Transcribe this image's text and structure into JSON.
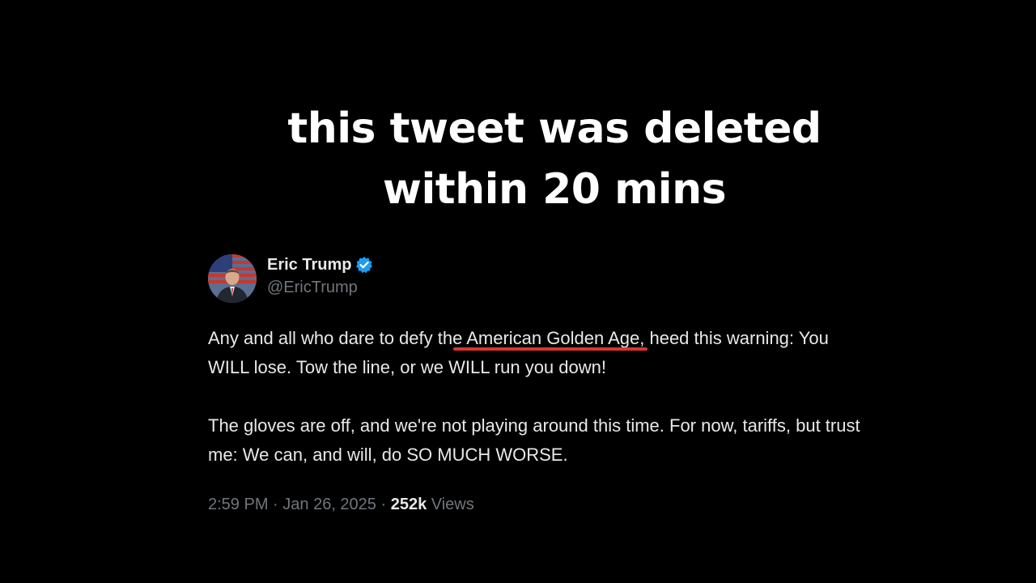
{
  "caption": {
    "line1": "this tweet was deleted",
    "line2": "within 20 mins"
  },
  "tweet": {
    "author": {
      "display_name": "Eric Trump",
      "handle": "@EricTrump",
      "verified": true,
      "avatar_icon": "profile-photo-icon"
    },
    "body": {
      "p1_before": "Any and all who dare to defy the ",
      "p1_highlight": "American Golden Age,",
      "p1_after": " heed this warning: You WILL lose. Tow the line, or we WILL run you down!",
      "p2": "The gloves are off, and we're not playing around this time. For now, tariffs, but trust me: We can, and will, do SO MUCH WORSE."
    },
    "meta": {
      "time": "2:59 PM",
      "sep1": " · ",
      "date": "Jan 26, 2025",
      "sep2": " · ",
      "views_count": "252k",
      "views_label": " Views"
    }
  },
  "colors": {
    "background": "#000000",
    "text_primary": "#e7e9ea",
    "text_secondary": "#71767b",
    "verified_blue": "#1d9bf0",
    "highlight_underline": "#d8352c"
  }
}
